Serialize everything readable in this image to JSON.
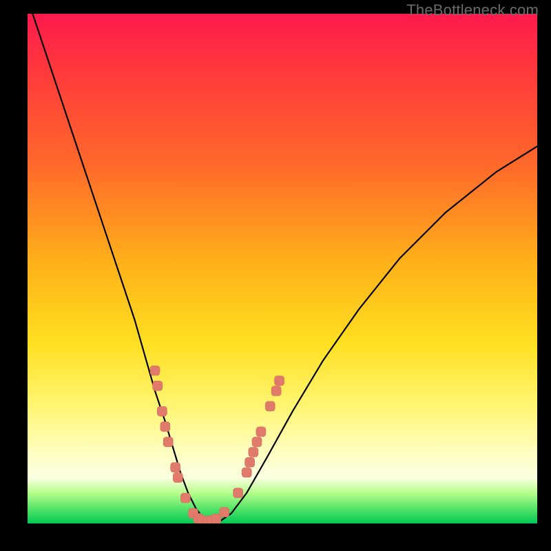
{
  "watermark": "TheBottleneck.com",
  "colors": {
    "gradient_top": "#ff1a4d",
    "gradient_mid": "#ffe022",
    "gradient_bottom": "#00c853",
    "curve": "#000000",
    "marker": "#e07a6b",
    "frame": "#000000"
  },
  "chart_data": {
    "type": "line",
    "title": "",
    "xlabel": "",
    "ylabel": "",
    "xlim": [
      0,
      100
    ],
    "ylim": [
      0,
      100
    ],
    "grid": false,
    "legend": false,
    "series": [
      {
        "name": "bottleneck-curve",
        "x": [
          0,
          3,
          6,
          9,
          12,
          15,
          18,
          21,
          23,
          25,
          27,
          28.5,
          30,
          31.5,
          33,
          34.5,
          36,
          38,
          40,
          43,
          47,
          52,
          58,
          65,
          73,
          82,
          92,
          100
        ],
        "y": [
          103,
          94,
          85,
          76,
          67,
          58,
          49,
          40,
          33,
          26,
          20,
          15,
          10,
          6,
          3,
          1,
          0.3,
          0.6,
          2,
          6,
          13,
          22,
          32,
          42,
          52,
          61,
          69,
          74
        ]
      }
    ],
    "markers": {
      "name": "highlighted-points",
      "points": [
        {
          "x": 25.0,
          "y": 30
        },
        {
          "x": 25.5,
          "y": 27
        },
        {
          "x": 26.4,
          "y": 22
        },
        {
          "x": 27.0,
          "y": 19
        },
        {
          "x": 27.6,
          "y": 16
        },
        {
          "x": 29.0,
          "y": 11
        },
        {
          "x": 29.5,
          "y": 9
        },
        {
          "x": 31.0,
          "y": 5
        },
        {
          "x": 32.5,
          "y": 2.0
        },
        {
          "x": 33.5,
          "y": 1.0
        },
        {
          "x": 34.3,
          "y": 0.6
        },
        {
          "x": 35.3,
          "y": 0.5
        },
        {
          "x": 36.2,
          "y": 0.6
        },
        {
          "x": 37.0,
          "y": 0.9
        },
        {
          "x": 38.6,
          "y": 2.2
        },
        {
          "x": 41.3,
          "y": 6
        },
        {
          "x": 43.0,
          "y": 10
        },
        {
          "x": 43.6,
          "y": 12
        },
        {
          "x": 44.3,
          "y": 14
        },
        {
          "x": 45.0,
          "y": 16
        },
        {
          "x": 45.8,
          "y": 18
        },
        {
          "x": 47.6,
          "y": 23
        },
        {
          "x": 48.8,
          "y": 26
        },
        {
          "x": 49.4,
          "y": 28
        }
      ]
    }
  }
}
